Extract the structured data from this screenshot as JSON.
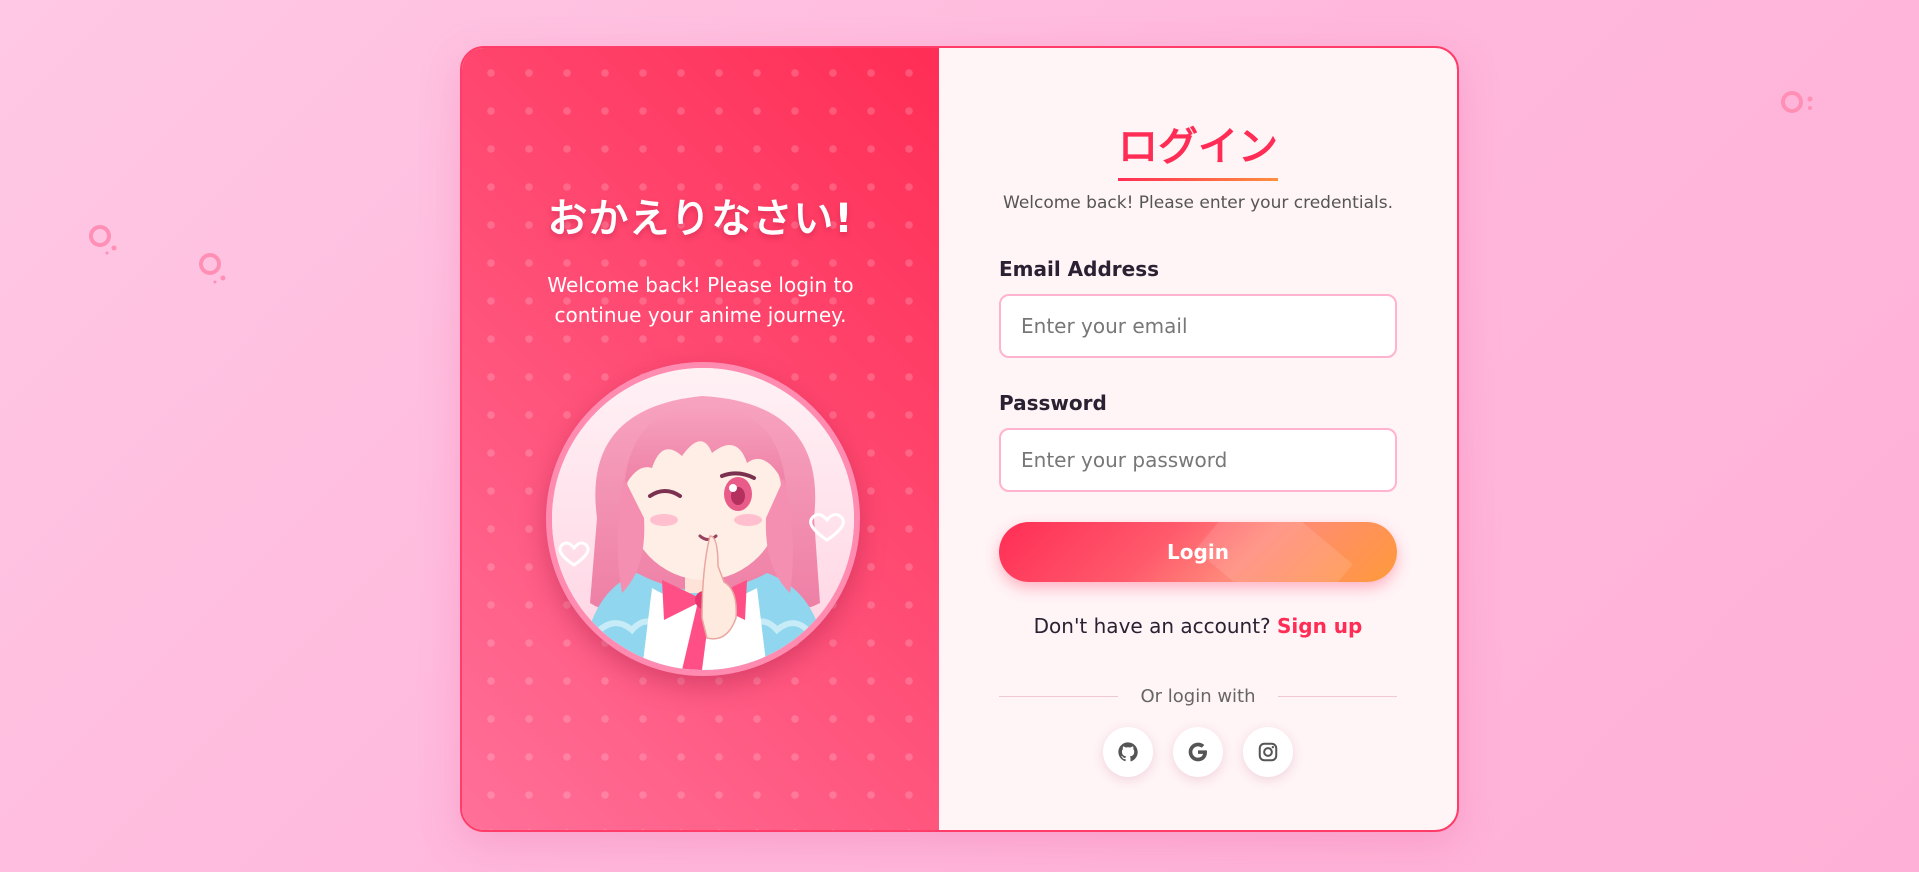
{
  "left_panel": {
    "heading": "おかえりなさい!",
    "message": "Welcome back! Please login to continue your anime journey.",
    "avatar_icon": "anime-girl-avatar"
  },
  "form": {
    "title": "ログイン",
    "subtitle": "Welcome back! Please enter your credentials.",
    "email_label": "Email Address",
    "email_placeholder": "Enter your email",
    "password_label": "Password",
    "password_placeholder": "Enter your password",
    "login_label": "Login",
    "signup_prompt": "Don't have an account?",
    "signup_link": "Sign up",
    "divider_text": "Or login with",
    "social": [
      "github-icon",
      "google-icon",
      "instagram-icon"
    ]
  },
  "colors": {
    "accent": "#ff2d55",
    "accent_orange": "#ff9a3a",
    "background": "#ffc8e4",
    "panel": "#fff4f6"
  }
}
